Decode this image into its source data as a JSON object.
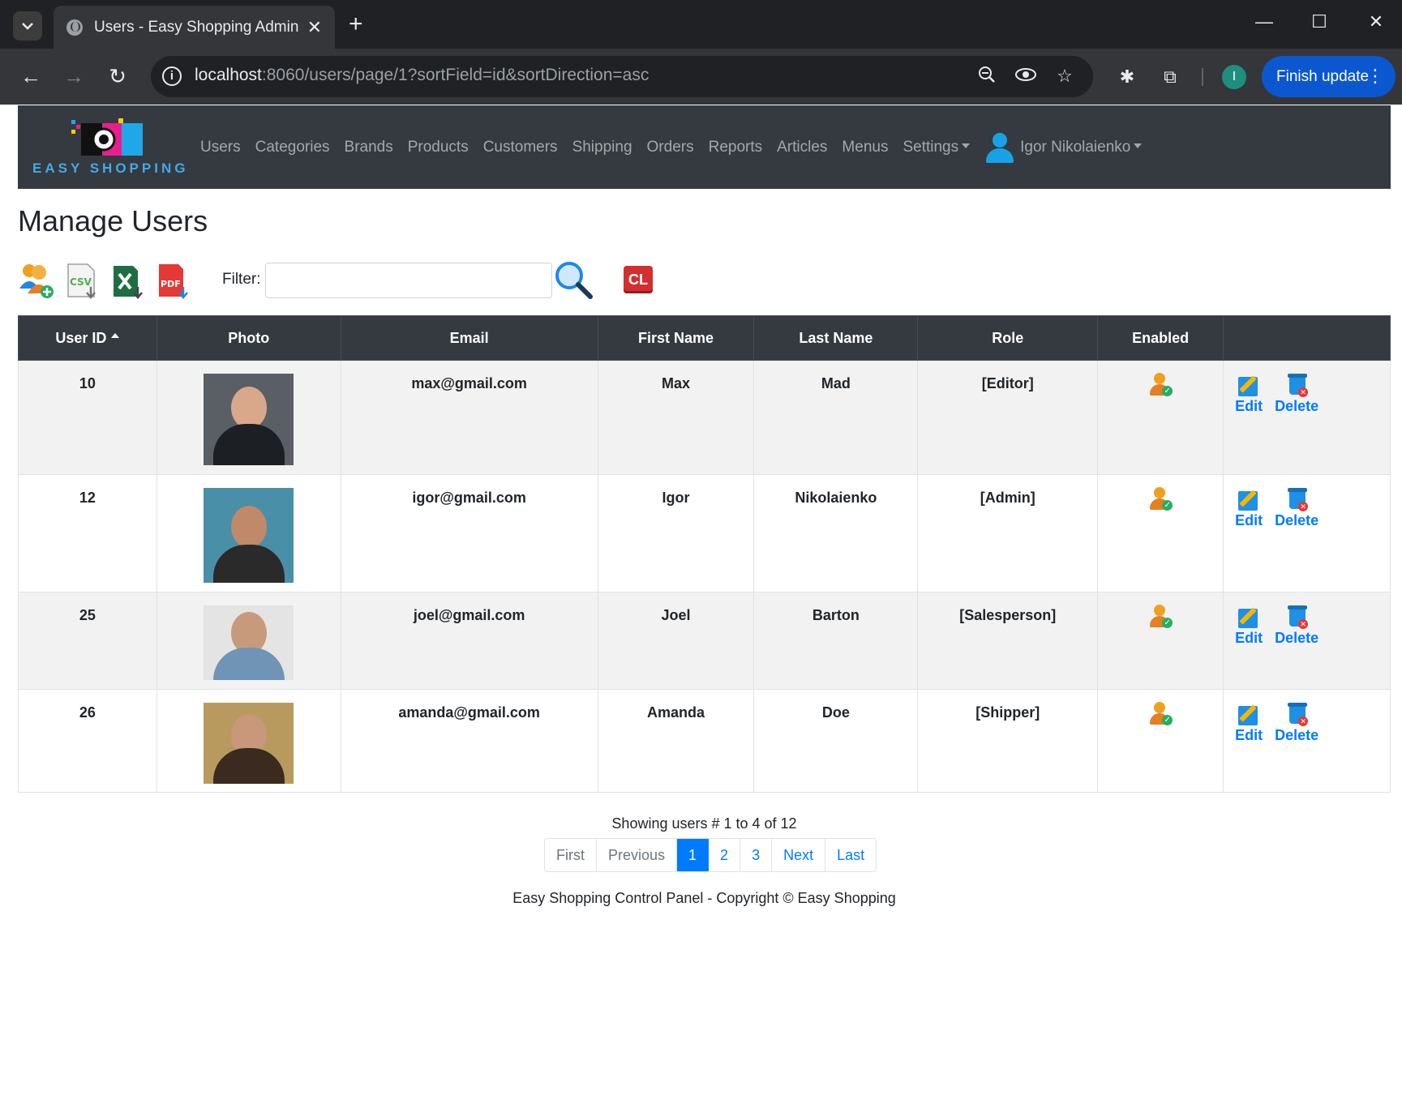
{
  "browser": {
    "tab_title": "Users - Easy Shopping Admin",
    "url_host": "localhost",
    "url_rest": ":8060/users/page/1?sortField=id&sortDirection=asc",
    "profile_initial": "I",
    "finish_update_label": "Finish update"
  },
  "app": {
    "logo_text": "EASY SHOPPING",
    "nav": [
      "Users",
      "Categories",
      "Brands",
      "Products",
      "Customers",
      "Shipping",
      "Orders",
      "Reports",
      "Articles",
      "Menus"
    ],
    "settings_label": "Settings",
    "user_name": "Igor Nikolaienko"
  },
  "page": {
    "title": "Manage Users",
    "filter_label": "Filter:",
    "filter_value": "",
    "clear_label": "CL",
    "csv_label": "CSV",
    "pdf_label": "PDF"
  },
  "table": {
    "headers": [
      "User ID",
      "Photo",
      "Email",
      "First Name",
      "Last Name",
      "Role",
      "Enabled",
      ""
    ],
    "rows": [
      {
        "id": "10",
        "email": "max@gmail.com",
        "first": "Max",
        "last": "Mad",
        "role": "[Editor]",
        "edit": "Edit",
        "delete": "Delete"
      },
      {
        "id": "12",
        "email": "igor@gmail.com",
        "first": "Igor",
        "last": "Nikolaienko",
        "role": "[Admin]",
        "edit": "Edit",
        "delete": "Delete"
      },
      {
        "id": "25",
        "email": "joel@gmail.com",
        "first": "Joel",
        "last": "Barton",
        "role": "[Salesperson]",
        "edit": "Edit",
        "delete": "Delete"
      },
      {
        "id": "26",
        "email": "amanda@gmail.com",
        "first": "Amanda",
        "last": "Doe",
        "role": "[Shipper]",
        "edit": "Edit",
        "delete": "Delete"
      }
    ]
  },
  "pagination": {
    "summary": "Showing users # 1 to 4 of 12",
    "first": "First",
    "previous": "Previous",
    "pages": [
      "1",
      "2",
      "3"
    ],
    "next": "Next",
    "last": "Last"
  },
  "footer": "Easy Shopping Control Panel - Copyright © Easy Shopping",
  "colors": {
    "navbar": "#343a40",
    "link": "#007bff",
    "table_header": "#343a40",
    "row_odd": "#f2f2f2"
  }
}
